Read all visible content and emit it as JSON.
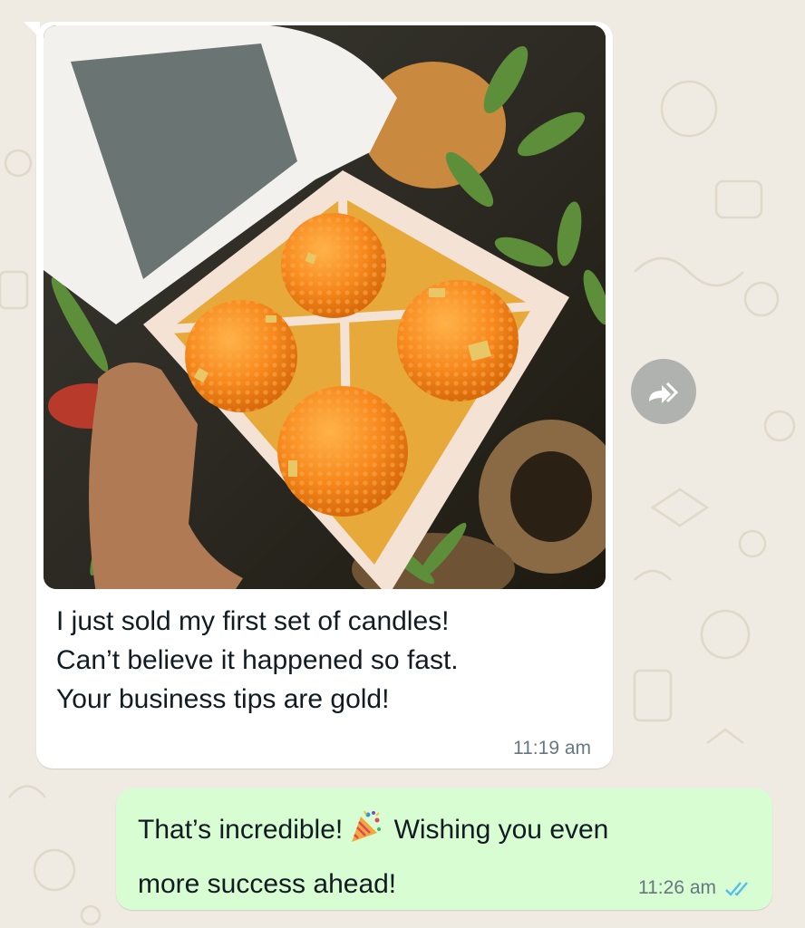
{
  "chat": {
    "incoming": {
      "image": {
        "alt": "Hand holding box of four orange laddoo-shaped candles"
      },
      "lines": [
        "I just sold my first set of candles!",
        "Can’t believe it happened so fast.",
        "Your business tips are gold!"
      ],
      "time": "11:19 am"
    },
    "outgoing": {
      "line1_before": "That’s incredible!",
      "emoji": "🎉",
      "line1_after": "Wishing you even",
      "line2": "more success ahead!",
      "time": "11:26 am",
      "status": "read"
    },
    "forward_icon": "forward-icon"
  },
  "colors": {
    "wallpaper": "#efeae2",
    "incoming_bubble": "#ffffff",
    "outgoing_bubble": "#d9fdd3",
    "timestamp": "#667781",
    "read_ticks": "#53bdeb"
  }
}
